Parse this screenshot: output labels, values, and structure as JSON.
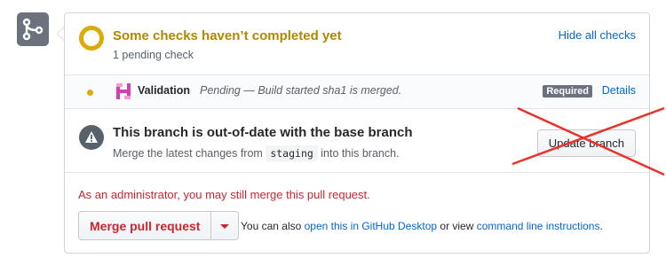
{
  "status": {
    "title": "Some checks haven’t completed yet",
    "subtitle": "1 pending check",
    "hide_link": "Hide all checks",
    "accent_color": "#dbab09"
  },
  "check": {
    "name": "Validation",
    "description": "Pending — Build started sha1 is merged.",
    "badge": "Required",
    "details_link": "Details"
  },
  "outdated": {
    "title": "This branch is out-of-date with the base branch",
    "desc_before": "Merge the latest changes from",
    "branch": "staging",
    "desc_after": "into this branch.",
    "button": "Update branch"
  },
  "merge": {
    "admin_message": "As an administrator, you may still merge this pull request.",
    "button": "Merge pull request",
    "also_prefix": "You can also",
    "desktop_link": "open this in GitHub Desktop",
    "middle": "or view",
    "cli_link": "command line instructions",
    "suffix": "."
  },
  "annotation": {
    "cross_color": "#e8332a"
  }
}
